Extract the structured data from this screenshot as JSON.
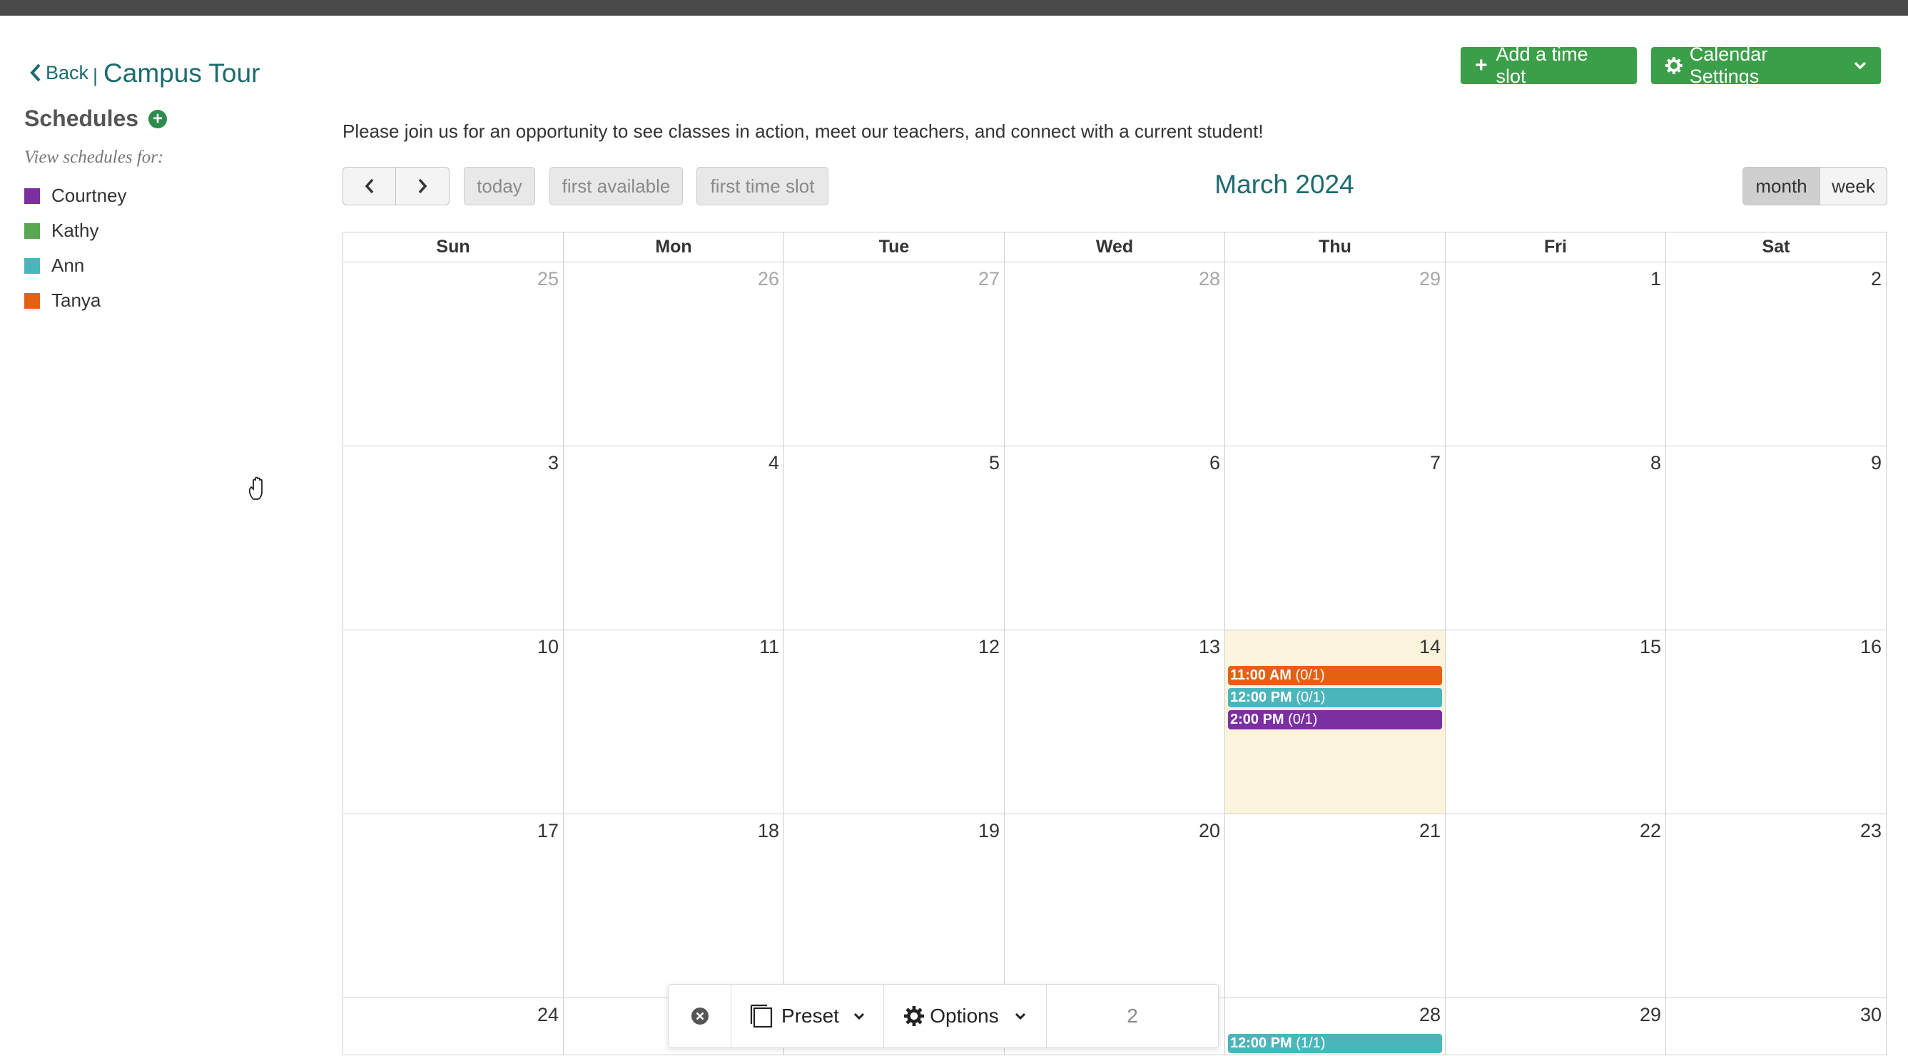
{
  "header": {
    "back_label": "Back",
    "separator": "|",
    "title": "Campus Tour",
    "add_slot_label": "Add a time slot",
    "settings_label": "Calendar Settings"
  },
  "sidebar": {
    "title": "Schedules",
    "view_for": "View schedules for:",
    "schedules": [
      {
        "name": "Courtney",
        "color": "#7b2fa0"
      },
      {
        "name": "Kathy",
        "color": "#5aa652"
      },
      {
        "name": "Ann",
        "color": "#4bb5bc"
      },
      {
        "name": "Tanya",
        "color": "#e46112"
      }
    ]
  },
  "intro_text": "Please join us for an opportunity to see classes in action, meet our teachers, and connect with a current student!",
  "toolbar": {
    "today_label": "today",
    "first_available_label": "first available",
    "first_slot_label": "first time slot",
    "month_title": "March 2024",
    "month_view_label": "month",
    "week_view_label": "week"
  },
  "calendar": {
    "weekdays": [
      "Sun",
      "Mon",
      "Tue",
      "Wed",
      "Thu",
      "Fri",
      "Sat"
    ],
    "weeks": [
      [
        {
          "d": "25",
          "other": true
        },
        {
          "d": "26",
          "other": true
        },
        {
          "d": "27",
          "other": true
        },
        {
          "d": "28",
          "other": true
        },
        {
          "d": "29",
          "other": true
        },
        {
          "d": "1"
        },
        {
          "d": "2"
        }
      ],
      [
        {
          "d": "3"
        },
        {
          "d": "4"
        },
        {
          "d": "5"
        },
        {
          "d": "6"
        },
        {
          "d": "7"
        },
        {
          "d": "8"
        },
        {
          "d": "9"
        }
      ],
      [
        {
          "d": "10"
        },
        {
          "d": "11"
        },
        {
          "d": "12"
        },
        {
          "d": "13"
        },
        {
          "d": "14",
          "today": true,
          "events": [
            {
              "time": "11:00 AM",
              "count": "(0/1)",
              "color": "#e46112"
            },
            {
              "time": "12:00 PM",
              "count": "(0/1)",
              "color": "#4bb5bc"
            },
            {
              "time": "2:00 PM",
              "count": "(0/1)",
              "color": "#7b2fa0"
            }
          ]
        },
        {
          "d": "15"
        },
        {
          "d": "16"
        }
      ],
      [
        {
          "d": "17"
        },
        {
          "d": "18"
        },
        {
          "d": "19"
        },
        {
          "d": "20"
        },
        {
          "d": "21"
        },
        {
          "d": "22"
        },
        {
          "d": "23"
        }
      ],
      [
        {
          "d": "24"
        },
        {
          "d": ""
        },
        {
          "d": ""
        },
        {
          "d": ""
        },
        {
          "d": "28",
          "events": [
            {
              "time": "12:00 PM",
              "count": "(1/1)",
              "color": "#4bb5bc"
            }
          ]
        },
        {
          "d": "29"
        },
        {
          "d": "30"
        }
      ]
    ]
  },
  "floating_bar": {
    "preset_label": "Preset",
    "options_label": "Options",
    "count": "2"
  }
}
